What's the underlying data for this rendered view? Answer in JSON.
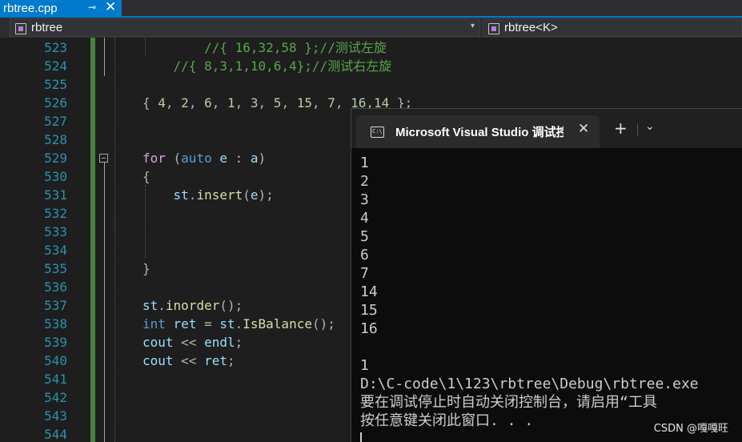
{
  "tab": {
    "filename": "rbtree.cpp",
    "pin_glyph": "⊸",
    "close_glyph": "✕"
  },
  "navbar": {
    "scope": "rbtree",
    "member": "rbtree<K>",
    "arrow": "▾"
  },
  "editor": {
    "lines": [
      {
        "n": "523",
        "tokens": [
          [
            "cm",
            "        //{ 16,32,58 };//测试左旋"
          ]
        ]
      },
      {
        "n": "524",
        "tokens": [
          [
            "cm",
            "    //{ 8,3,1,10,6,4};//测试右左旋"
          ]
        ]
      },
      {
        "n": "525",
        "tokens": []
      },
      {
        "n": "526",
        "tokens": [
          [
            "op",
            "{ "
          ],
          [
            "num",
            "4"
          ],
          [
            "op",
            ", "
          ],
          [
            "num",
            "2"
          ],
          [
            "op",
            ", "
          ],
          [
            "num",
            "6"
          ],
          [
            "op",
            ", "
          ],
          [
            "num",
            "1"
          ],
          [
            "op",
            ", "
          ],
          [
            "num",
            "3"
          ],
          [
            "op",
            ", "
          ],
          [
            "num",
            "5"
          ],
          [
            "op",
            ", "
          ],
          [
            "num",
            "15"
          ],
          [
            "op",
            ", "
          ],
          [
            "num",
            "7"
          ],
          [
            "op",
            ", "
          ],
          [
            "num",
            "16"
          ],
          [
            "op",
            ","
          ],
          [
            "num",
            "14"
          ],
          [
            "op",
            " };"
          ]
        ]
      },
      {
        "n": "527",
        "tokens": []
      },
      {
        "n": "528",
        "tokens": []
      },
      {
        "n": "529",
        "tokens": [
          [
            "kwp",
            "for"
          ],
          [
            "op",
            " ("
          ],
          [
            "kw",
            "auto"
          ],
          [
            "op",
            " "
          ],
          [
            "var",
            "e"
          ],
          [
            "op",
            " : "
          ],
          [
            "var",
            "a"
          ],
          [
            "op",
            ")"
          ]
        ]
      },
      {
        "n": "530",
        "tokens": [
          [
            "op",
            "{"
          ]
        ]
      },
      {
        "n": "531",
        "tokens": [
          [
            "op",
            "    "
          ],
          [
            "var",
            "st"
          ],
          [
            "op",
            "."
          ],
          [
            "fn",
            "insert"
          ],
          [
            "op",
            "("
          ],
          [
            "var",
            "e"
          ],
          [
            "op",
            ");"
          ]
        ]
      },
      {
        "n": "532",
        "tokens": []
      },
      {
        "n": "533",
        "tokens": []
      },
      {
        "n": "534",
        "tokens": []
      },
      {
        "n": "535",
        "tokens": [
          [
            "op",
            "}"
          ]
        ]
      },
      {
        "n": "536",
        "tokens": []
      },
      {
        "n": "537",
        "tokens": [
          [
            "var",
            "st"
          ],
          [
            "op",
            "."
          ],
          [
            "fn",
            "inorder"
          ],
          [
            "op",
            "();"
          ]
        ]
      },
      {
        "n": "538",
        "tokens": [
          [
            "kw",
            "int"
          ],
          [
            "op",
            " "
          ],
          [
            "var",
            "ret"
          ],
          [
            "op",
            " = "
          ],
          [
            "var",
            "st"
          ],
          [
            "op",
            "."
          ],
          [
            "fn",
            "IsBalance"
          ],
          [
            "op",
            "();"
          ]
        ]
      },
      {
        "n": "539",
        "tokens": [
          [
            "var",
            "cout"
          ],
          [
            "op",
            " << "
          ],
          [
            "var",
            "endl"
          ],
          [
            "op",
            ";"
          ]
        ]
      },
      {
        "n": "540",
        "tokens": [
          [
            "var",
            "cout"
          ],
          [
            "op",
            " << "
          ],
          [
            "var",
            "ret"
          ],
          [
            "op",
            ";"
          ]
        ]
      },
      {
        "n": "541",
        "tokens": []
      },
      {
        "n": "542",
        "tokens": []
      },
      {
        "n": "543",
        "tokens": []
      },
      {
        "n": "544",
        "tokens": []
      }
    ]
  },
  "console": {
    "tab_title": "Microsoft Visual Studio 调试控制台",
    "icon_text": "C:\\",
    "close_glyph": "✕",
    "plus_glyph": "+",
    "dropdown_glyph": "⌄",
    "output": [
      "1",
      "2",
      "3",
      "4",
      "5",
      "6",
      "7",
      "14",
      "15",
      "16",
      "",
      "1",
      "D:\\C-code\\1\\123\\rbtree\\Debug\\rbtree.exe",
      "要在调试停止时自动关闭控制台，请启用“工具",
      "按任意键关闭此窗口. . ."
    ]
  },
  "watermark": "CSDN @嘎嘎旺",
  "colors": {
    "accent": "#007acc",
    "line_number": "#2b91af",
    "comment": "#57a64a",
    "keyword": "#569cd6",
    "control_keyword": "#d8a0df",
    "number": "#b5cea8",
    "variable": "#9cdcfe",
    "function": "#dcdcaa"
  }
}
